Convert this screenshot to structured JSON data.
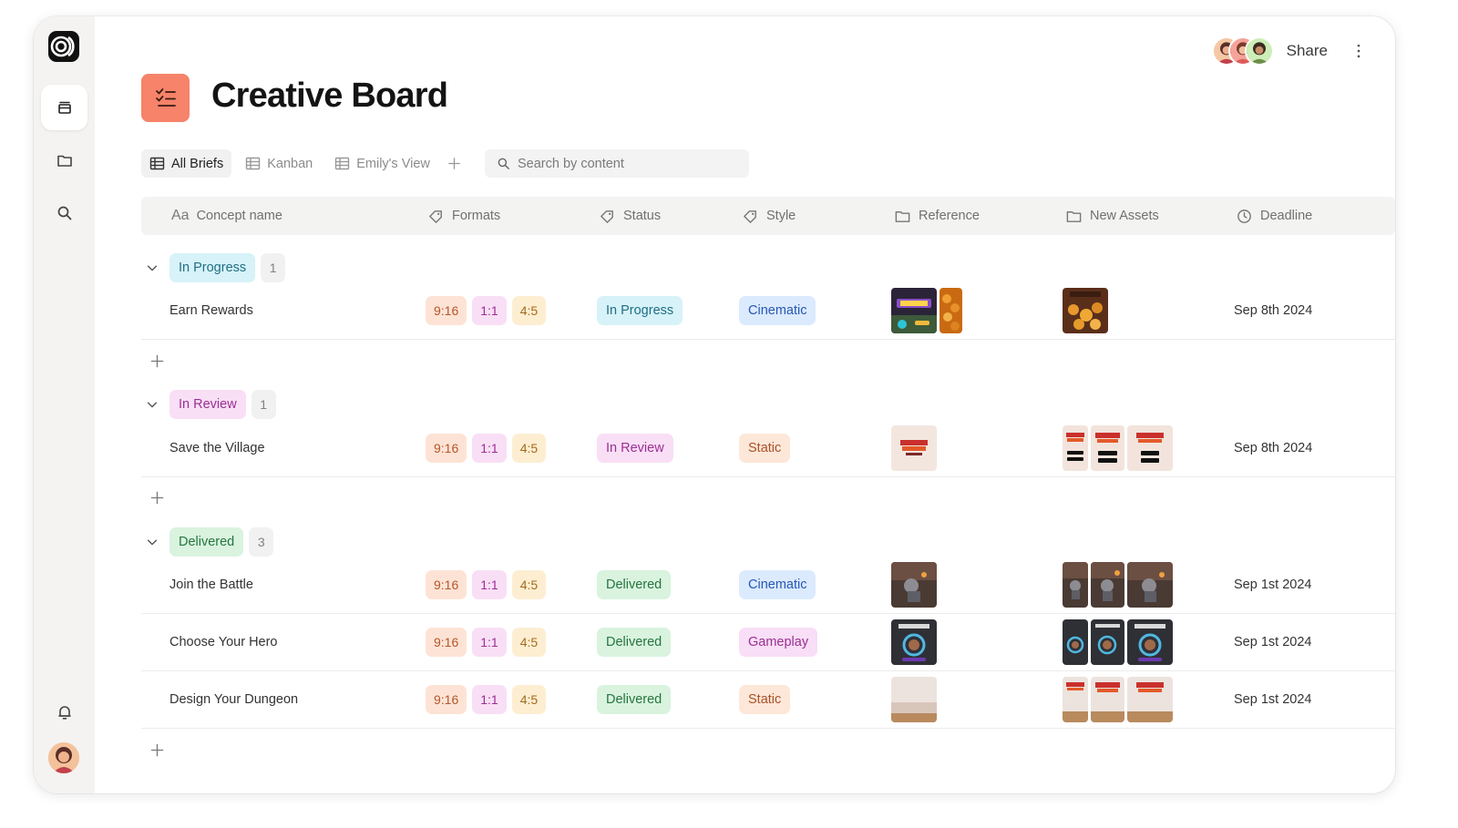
{
  "app": {
    "title": "Creative Board",
    "share_label": "Share"
  },
  "sidebar": {
    "items": [
      {
        "icon": "layers-icon",
        "active": true
      },
      {
        "icon": "folder-icon",
        "active": false
      },
      {
        "icon": "search-icon",
        "active": false
      }
    ],
    "bottom": [
      {
        "icon": "bell-icon"
      },
      {
        "icon": "user-avatar"
      }
    ]
  },
  "views": {
    "tabs": [
      {
        "label": "All Briefs",
        "active": true
      },
      {
        "label": "Kanban",
        "active": false
      },
      {
        "label": "Emily's View",
        "active": false
      }
    ],
    "search_placeholder": "Search by content"
  },
  "table": {
    "columns": [
      "Concept name",
      "Formats",
      "Status",
      "Style",
      "Reference",
      "New Assets",
      "Deadline"
    ],
    "groups": [
      {
        "label": "In Progress",
        "count": "1",
        "rows": [
          {
            "name": "Earn Rewards",
            "formats": [
              "9:16",
              "1:1",
              "4:5"
            ],
            "status": "In Progress",
            "style": "Cinematic",
            "deadline": "Sep 8th 2024"
          }
        ]
      },
      {
        "label": "In Review",
        "count": "1",
        "rows": [
          {
            "name": "Save the Village",
            "formats": [
              "9:16",
              "1:1",
              "4:5"
            ],
            "status": "In Review",
            "style": "Static",
            "deadline": "Sep 8th 2024"
          }
        ]
      },
      {
        "label": "Delivered",
        "count": "3",
        "rows": [
          {
            "name": "Join the Battle",
            "formats": [
              "9:16",
              "1:1",
              "4:5"
            ],
            "status": "Delivered",
            "style": "Cinematic",
            "deadline": "Sep 1st 2024"
          },
          {
            "name": "Choose Your Hero",
            "formats": [
              "9:16",
              "1:1",
              "4:5"
            ],
            "status": "Delivered",
            "style": "Gameplay",
            "deadline": "Sep 1st 2024"
          },
          {
            "name": "Design Your Dungeon",
            "formats": [
              "9:16",
              "1:1",
              "4:5"
            ],
            "status": "Delivered",
            "style": "Static",
            "deadline": "Sep 1st 2024"
          }
        ]
      }
    ]
  },
  "colors": {
    "accent": "#f6836a",
    "in_progress": "#d7f2f8",
    "in_review": "#f9dff6",
    "delivered": "#d9f3df",
    "cinematic": "#dceafe",
    "static": "#fde7d8"
  }
}
